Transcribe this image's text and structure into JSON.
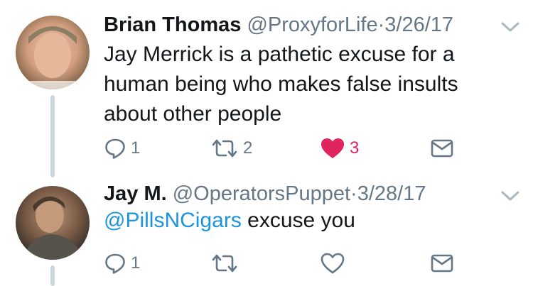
{
  "tweets": [
    {
      "name": "Brian Thomas",
      "handle": "@ProxyforLife",
      "separator": "·",
      "date": "3/26/17",
      "text": "Jay Merrick is a pathetic excuse for a human being who makes false insults about other people",
      "replies": "1",
      "retweets": "2",
      "likes": "3",
      "liked": true
    },
    {
      "name": "Jay M.",
      "handle": "@OperatorsPuppet",
      "separator": "·",
      "date": "3/28/17",
      "mention": "@PillsNCigars",
      "text": " excuse you",
      "replies": "1",
      "retweets": "",
      "likes": "",
      "liked": false
    }
  ],
  "colors": {
    "text": "#14171a",
    "secondary": "#657786",
    "link": "#1b95e0",
    "like_active": "#e0245e",
    "thread_line": "#ccd6dd"
  },
  "icons": {
    "reply": "reply-icon",
    "retweet": "retweet-icon",
    "like": "heart-icon",
    "dm": "envelope-icon",
    "menu": "chevron-down-icon"
  }
}
